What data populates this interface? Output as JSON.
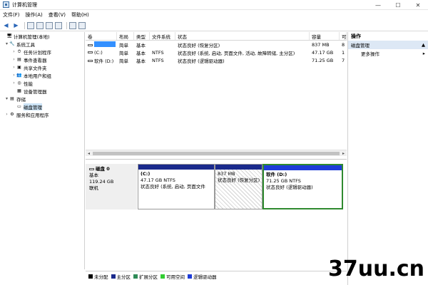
{
  "window": {
    "title": "计算机管理",
    "min_glyph": "—",
    "max_glyph": "☐",
    "close_glyph": "✕"
  },
  "menu": [
    "文件(F)",
    "操作(A)",
    "查看(V)",
    "帮助(H)"
  ],
  "tree": [
    {
      "label": "计算机管理(本地)",
      "twisty": "",
      "icon": "🖥",
      "indent": 0
    },
    {
      "label": "系统工具",
      "twisty": "▾",
      "icon": "🔧",
      "indent": 1
    },
    {
      "label": "任务计划程序",
      "twisty": "›",
      "icon": "⏱",
      "indent": 2
    },
    {
      "label": "事件查看器",
      "twisty": "›",
      "icon": "▤",
      "indent": 2
    },
    {
      "label": "共享文件夹",
      "twisty": "›",
      "icon": "▣",
      "indent": 2
    },
    {
      "label": "本地用户和组",
      "twisty": "›",
      "icon": "👥",
      "indent": 2
    },
    {
      "label": "性能",
      "twisty": "›",
      "icon": "◎",
      "indent": 2
    },
    {
      "label": "设备管理器",
      "twisty": "",
      "icon": "▦",
      "indent": 2
    },
    {
      "label": "存储",
      "twisty": "▾",
      "icon": "▤",
      "indent": 1
    },
    {
      "label": "磁盘管理",
      "twisty": "",
      "icon": "▭",
      "indent": 2,
      "selected": true
    },
    {
      "label": "服务和应用程序",
      "twisty": "›",
      "icon": "⚙",
      "indent": 1
    }
  ],
  "volume_table": {
    "headers": [
      "卷",
      "布局",
      "类型",
      "文件系统",
      "状态",
      "容量",
      "可"
    ],
    "rows": [
      [
        "",
        "简单",
        "基本",
        "",
        "状态良好 (恢复分区)",
        "837 MB",
        "8"
      ],
      [
        "(C:)",
        "简单",
        "基本",
        "NTFS",
        "状态良好 (系统, 启动, 页面文件, 活动, 故障转储, 主分区)",
        "47.17 GB",
        "1"
      ],
      [
        "软件 (D:)",
        "简单",
        "基本",
        "NTFS",
        "状态良好 (逻辑驱动器)",
        "71.25 GB",
        "7"
      ]
    ]
  },
  "disk": {
    "name": "磁盘 0",
    "type": "基本",
    "size": "119.24 GB",
    "status": "联机",
    "partitions": [
      {
        "title": "(C:)",
        "size": "47.17 GB NTFS",
        "status": "状态良好 (系统, 启动, 页面文件"
      },
      {
        "title": "",
        "size": "837 MB",
        "status": "状态良好 (恢复分区)"
      },
      {
        "title": "软件  (D:)",
        "size": "71.25 GB NTFS",
        "status": "状态良好 (逻辑驱动器)"
      }
    ]
  },
  "legend": [
    {
      "label": "未分配",
      "color": "#000000"
    },
    {
      "label": "主分区",
      "color": "#1a2a8c"
    },
    {
      "label": "扩展分区",
      "color": "#2e8b57"
    },
    {
      "label": "可用空间",
      "color": "#32cd32"
    },
    {
      "label": "逻辑驱动器",
      "color": "#1d3cd8"
    }
  ],
  "actions": {
    "header": "操作",
    "section": "磁盘管理",
    "section_arrow": "▲",
    "more": "更多操作",
    "more_arrow": "▸"
  },
  "watermark": {
    "text": "37uu.cn"
  },
  "colors": {
    "selection": "#3390ff",
    "primary_partition": "#1a2a8c",
    "logical_drive": "#1d3cd8",
    "selected_border": "#2f8a2f",
    "actions_section_bg": "#dde8f5"
  }
}
